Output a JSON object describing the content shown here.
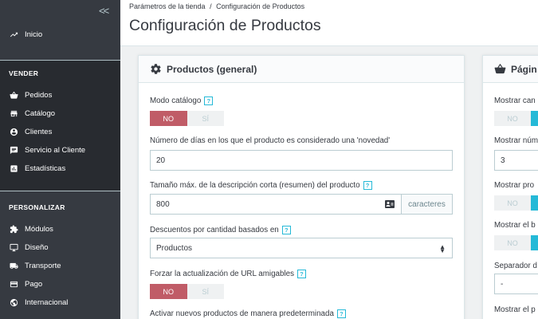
{
  "sidebar": {
    "collapse_label": "<<",
    "home": "Inicio",
    "sections": [
      {
        "title": "VENDER",
        "items": [
          "Pedidos",
          "Catálogo",
          "Clientes",
          "Servicio al Cliente",
          "Estadísticas"
        ]
      },
      {
        "title": "PERSONALIZAR",
        "items": [
          "Módulos",
          "Diseño",
          "Transporte",
          "Pago",
          "Internacional"
        ]
      }
    ]
  },
  "header": {
    "breadcrumb": [
      "Parámetros de la tienda",
      "Configuración de Productos"
    ],
    "breadcrumb_sep": "/",
    "title": "Configuración de Productos"
  },
  "general": {
    "title": "Productos (general)",
    "catalog_mode": {
      "label": "Modo catálogo",
      "no": "NO",
      "yes": "SÍ"
    },
    "new_days": {
      "label": "Número de días en los que el producto es considerado una 'novedad'",
      "value": "20"
    },
    "short_desc": {
      "label": "Tamaño máx. de la descripción corta (resumen) del producto",
      "value": "800",
      "suffix": "caracteres"
    },
    "discounts": {
      "label": "Descuentos por cantidad basados en",
      "value": "Productos"
    },
    "force_url": {
      "label": "Forzar la actualización de URL amigables",
      "no": "NO",
      "yes": "SÍ"
    },
    "activate_new": {
      "label": "Activar nuevos productos de manera predeterminada"
    },
    "help_glyph": "?"
  },
  "page": {
    "title": "Págin",
    "rows": [
      {
        "label": "Mostrar can",
        "no": "NO"
      },
      {
        "label": "Mostrar núm",
        "value": "3"
      },
      {
        "label": "Mostrar pro",
        "no": "NO"
      },
      {
        "label": "Mostrar el b",
        "no": "NO"
      },
      {
        "label": "Separador d",
        "value": "-"
      },
      {
        "label": "Mostrar el p"
      }
    ]
  }
}
